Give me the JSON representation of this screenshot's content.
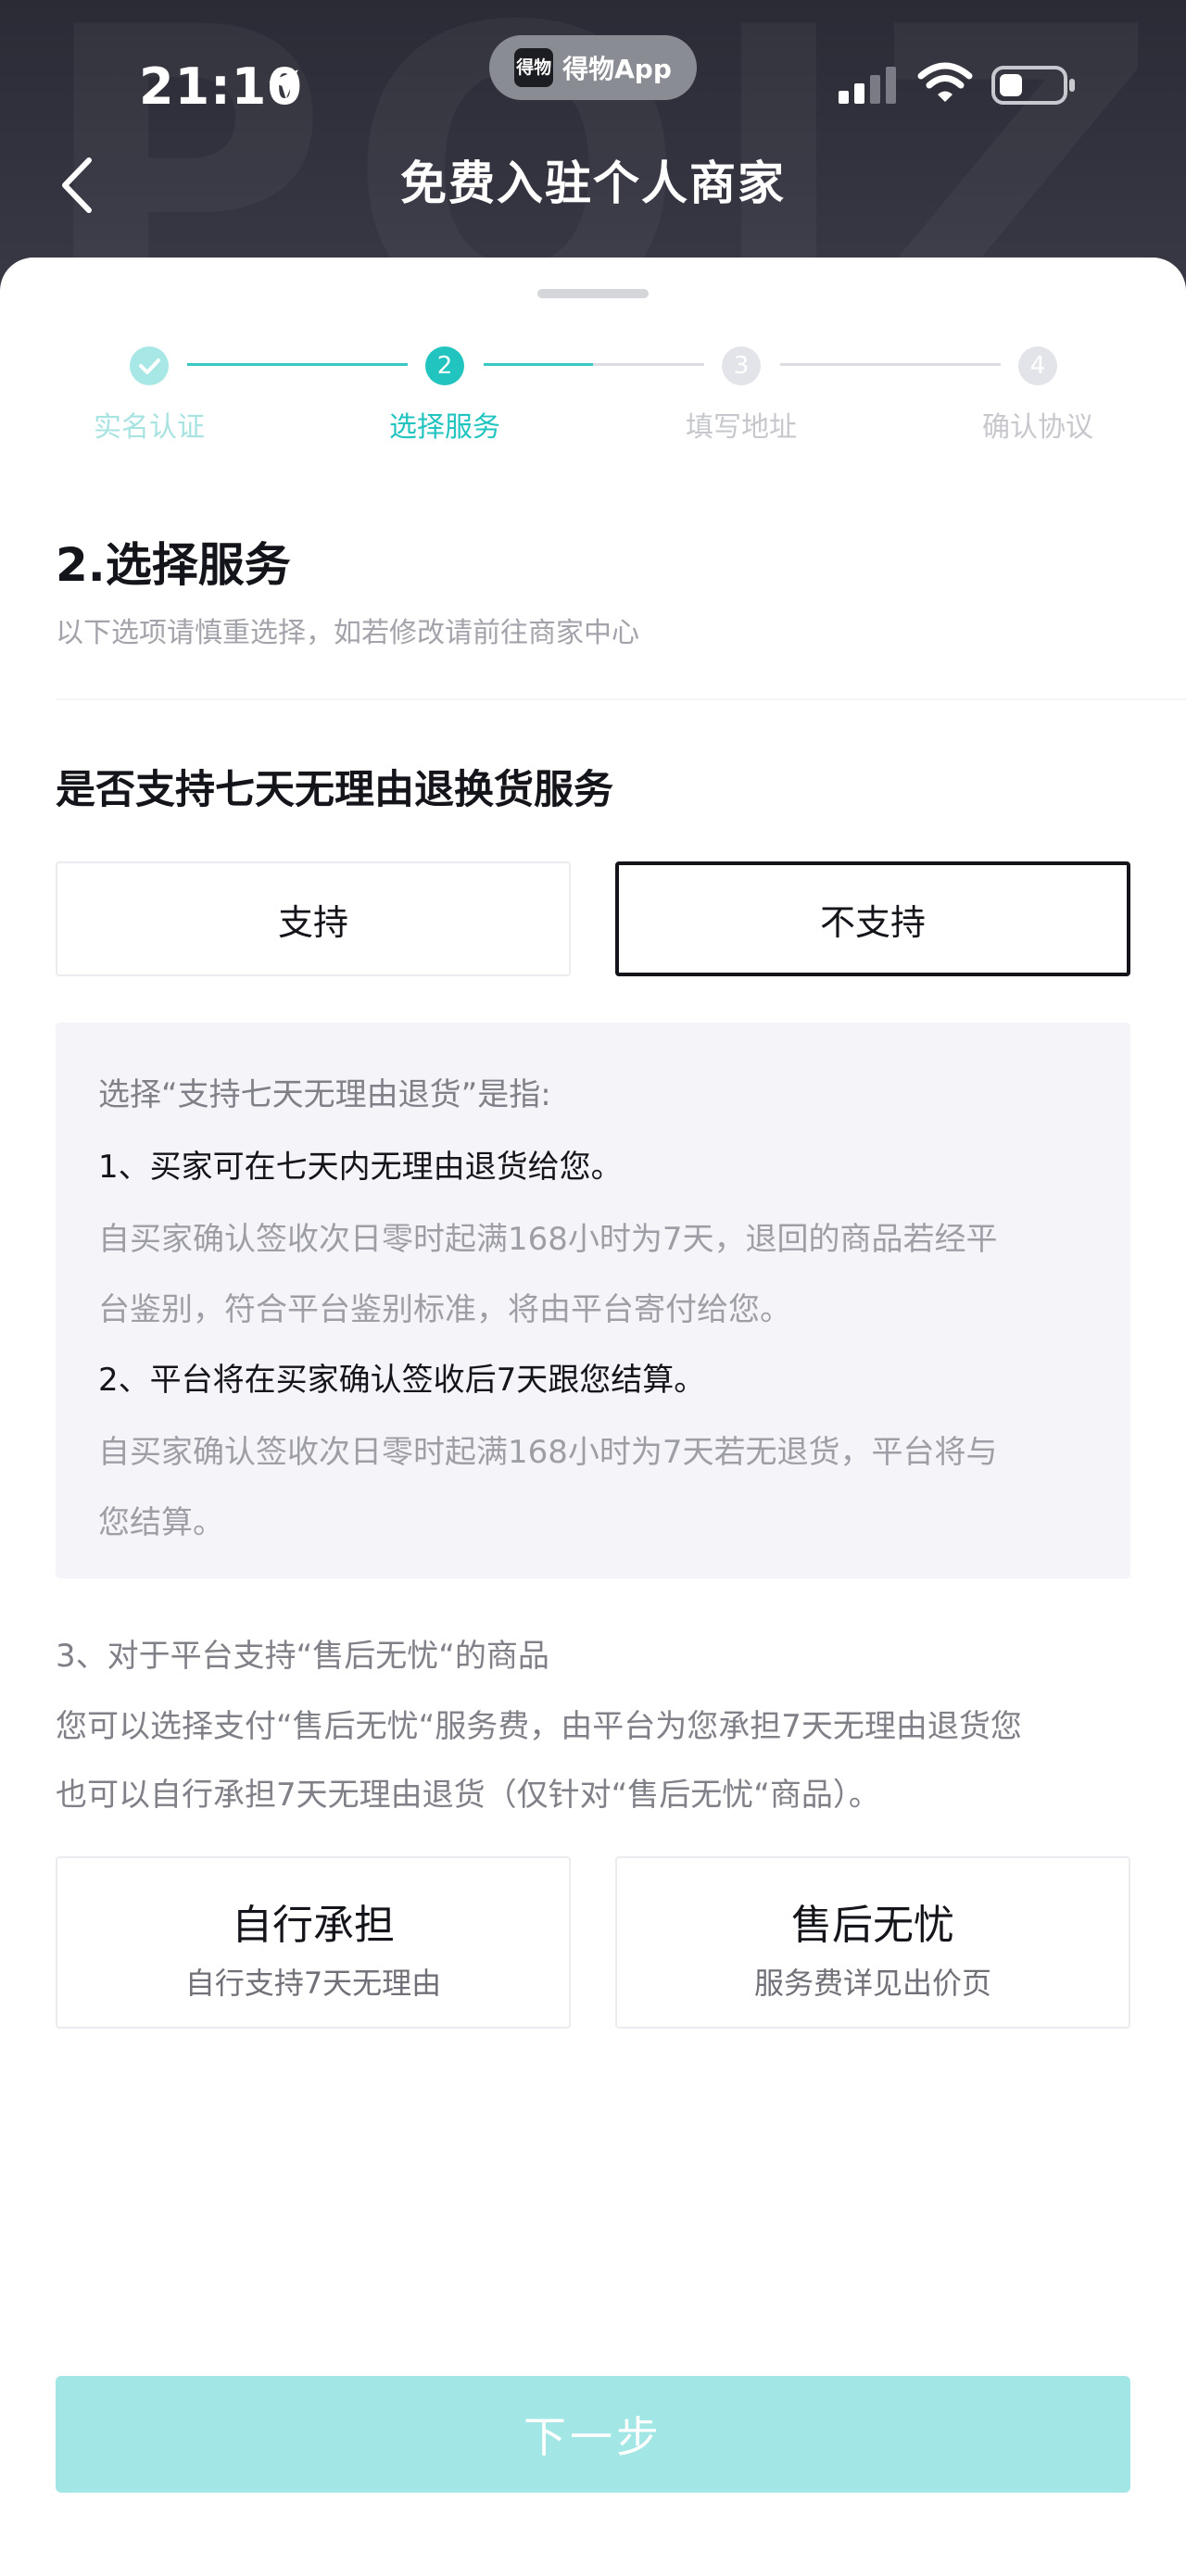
{
  "status_bar": {
    "time": "21:10",
    "app_badge": "得物App",
    "app_logo_text": "得物"
  },
  "nav": {
    "title": "免费入驻个人商家"
  },
  "steps": [
    {
      "number": "✓",
      "label": "实名认证",
      "state": "done"
    },
    {
      "number": "2",
      "label": "选择服务",
      "state": "active"
    },
    {
      "number": "3",
      "label": "填写地址",
      "state": "pending"
    },
    {
      "number": "4",
      "label": "确认协议",
      "state": "pending"
    }
  ],
  "section": {
    "title": "2.选择服务",
    "subtitle": "以下选项请慎重选择，如若修改请前往商家中心"
  },
  "question": {
    "title": "是否支持七天无理由退换货服务",
    "options": [
      {
        "label": "支持",
        "selected": false
      },
      {
        "label": "不支持",
        "selected": true
      }
    ]
  },
  "info": {
    "intro": "选择“支持七天无理由退货”是指:",
    "point1": "1、买家可在七天内无理由退货给您。",
    "point1_detail_line1": "自买家确认签收次日零时起满168小时为7天，退回的商品若经平",
    "point1_detail_line2": "台鉴别，符合平台鉴别标准，将由平台寄付给您。",
    "point2": "2、平台将在买家确认签收后7天跟您结算。",
    "point2_detail_line1": "自买家确认签收次日零时起满168小时为7天若无退货，平台将与",
    "point2_detail_line2": "您结算。"
  },
  "after_sales": {
    "heading": "3、对于平台支持“售后无忧“的商品",
    "desc_line1": "您可以选择支付“售后无忧“服务费，由平台为您承担7天无理由退货您",
    "desc_line2": "也可以自行承担7天无理由退货（仅针对“售后无忧“商品）。",
    "choices": [
      {
        "title": "自行承担",
        "subtitle": "自行支持7天无理由"
      },
      {
        "title": "售后无忧",
        "subtitle": "服务费详见出价页"
      }
    ]
  },
  "footer": {
    "next_label": "下一步"
  },
  "colors": {
    "accent": "#22c4c0",
    "next_disabled": "#a3e6e6",
    "header_bg": "#2b2b36"
  }
}
